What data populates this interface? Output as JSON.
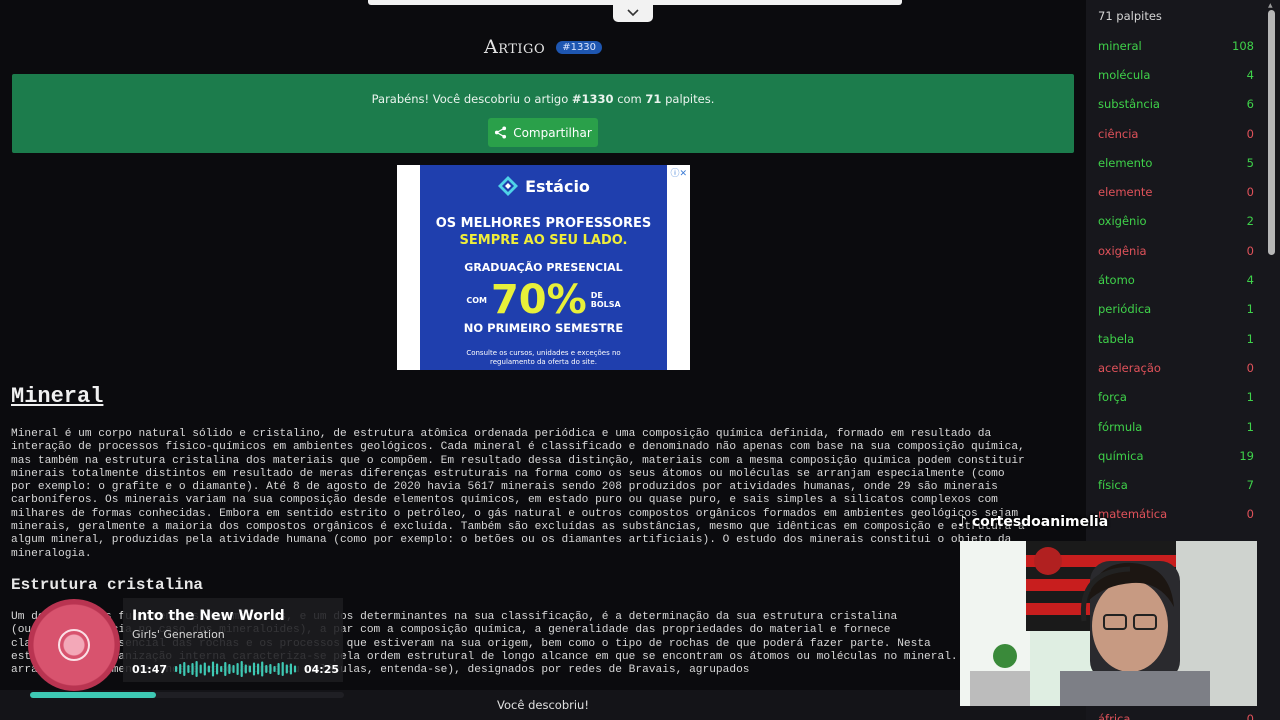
{
  "header": {
    "title": "Artigo",
    "article_badge": "#1330"
  },
  "banner": {
    "msg_pre": "Parabéns! Você descobriu o artigo ",
    "msg_article": "#1330",
    "msg_mid": " com ",
    "msg_guesses": "71",
    "msg_post": " palpites.",
    "share_label": "Compartilhar",
    "color": "#1c7c4c"
  },
  "ad": {
    "brand": "Estácio",
    "headline_1": "OS MELHORES PROFESSORES",
    "headline_2": "SEMPRE AO SEU LADO.",
    "line": "GRADUAÇÃO PRESENCIAL",
    "com": "COM",
    "percent": "70%",
    "de_bolsa_1": "DE",
    "de_bolsa_2": "BOLSA",
    "semester": "NO PRIMEIRO SEMESTRE",
    "fine_print": "Consulte os cursos, unidades e exceções no regulamento da oferta do site."
  },
  "article": {
    "title": "Mineral",
    "body": "Mineral é um corpo natural sólido e cristalino, de estrutura atômica ordenada periódica e uma composição química definida, formado em resultado da\ninteração de processos físico-químicos em ambientes geológicos. Cada mineral é classificado e denominado não apenas com base na sua composição química,\nmas também na estrutura cristalina dos materiais que o compõem. Em resultado dessa distinção, materiais com a mesma composição química podem constituir\nminerais totalmente distintos em resultado de meras diferenças estruturais na forma como os seus átomos ou moléculas se arranjam especialmente (como\npor exemplo: o grafite e o diamante). Até 8 de agosto de 2020 havia 5617 minerais sendo 208 produzidos por atividades humanas, onde 29 são minerais\ncarboníferos. Os minerais variam na sua composição desde elementos químicos, em estado puro ou quase puro, e sais simples a silicatos complexos com\nmilhares de formas conhecidas. Embora em sentido estrito o petróleo, o gás natural e outros compostos orgânicos formados em ambientes geológicos sejam\nminerais, geralmente a maioria dos compostos orgânicos é excluída. Também são excluídas as substâncias, mesmo que idênticas em composição e estrutura a\nalgum mineral, produzidas pela atividade humana (como por exemplo: o betões ou os diamantes artificiais). O estudo dos minerais constitui o objeto da\nmineralogia.",
    "section_title": "Estrutura cristalina",
    "section_body": "Um dos aspectos fundamentais dos minerais, e um dos determinantes na sua classificação, é a determinação da sua estrutura cristalina\n(ou a sua ausência no caso dos mineraloides), a par com a composição química, a generalidade das propriedades do material e fornece\nclassificação essencial das rochas e os processos que estiveram na sua origem, bem como o tipo de rochas de que poderá fazer parte. Nesta\nestrutura, a organização interna caracteriza-se pela ordem estrutural de longo alcance em que se encontram os átomos ou moléculas no mineral. Na natureza o\narranjo dos elementos (neste caso átomos ou moléculas, entenda-se), designados por redes de Bravais, agrupados"
  },
  "footer": {
    "status": "Você descobriu!"
  },
  "sidebar": {
    "header": "71 palpites",
    "guesses": [
      {
        "word": "mineral",
        "count": "108",
        "status": "close"
      },
      {
        "word": "molécula",
        "count": "4",
        "status": "close"
      },
      {
        "word": "substância",
        "count": "6",
        "status": "close"
      },
      {
        "word": "ciência",
        "count": "0",
        "status": "far"
      },
      {
        "word": "elemento",
        "count": "5",
        "status": "close"
      },
      {
        "word": "elemente",
        "count": "0",
        "status": "far"
      },
      {
        "word": "oxigênio",
        "count": "2",
        "status": "close"
      },
      {
        "word": "oxigênia",
        "count": "0",
        "status": "far"
      },
      {
        "word": "átomo",
        "count": "4",
        "status": "close"
      },
      {
        "word": "periódica",
        "count": "1",
        "status": "close"
      },
      {
        "word": "tabela",
        "count": "1",
        "status": "close"
      },
      {
        "word": "aceleração",
        "count": "0",
        "status": "far"
      },
      {
        "word": "força",
        "count": "1",
        "status": "close"
      },
      {
        "word": "fórmula",
        "count": "1",
        "status": "close"
      },
      {
        "word": "química",
        "count": "19",
        "status": "close"
      },
      {
        "word": "física",
        "count": "7",
        "status": "close"
      },
      {
        "word": "matemática",
        "count": "0",
        "status": "far"
      },
      {
        "word": "",
        "count": "",
        "status": "far"
      },
      {
        "word": "",
        "count": "",
        "status": "far"
      },
      {
        "word": "",
        "count": "",
        "status": "far"
      },
      {
        "word": "",
        "count": "",
        "status": "far"
      },
      {
        "word": "",
        "count": "",
        "status": "far"
      },
      {
        "word": "",
        "count": "",
        "status": "far"
      },
      {
        "word": "áfrica",
        "count": "0",
        "status": "far"
      }
    ]
  },
  "music_player": {
    "title": "Into the New World",
    "artist": "Girls' Generation",
    "current_time": "01:47",
    "total_time": "04:25",
    "progress": 0.4,
    "accent": "#3ec9b4"
  },
  "stream": {
    "channel_label": "cortesdoanimelia"
  }
}
